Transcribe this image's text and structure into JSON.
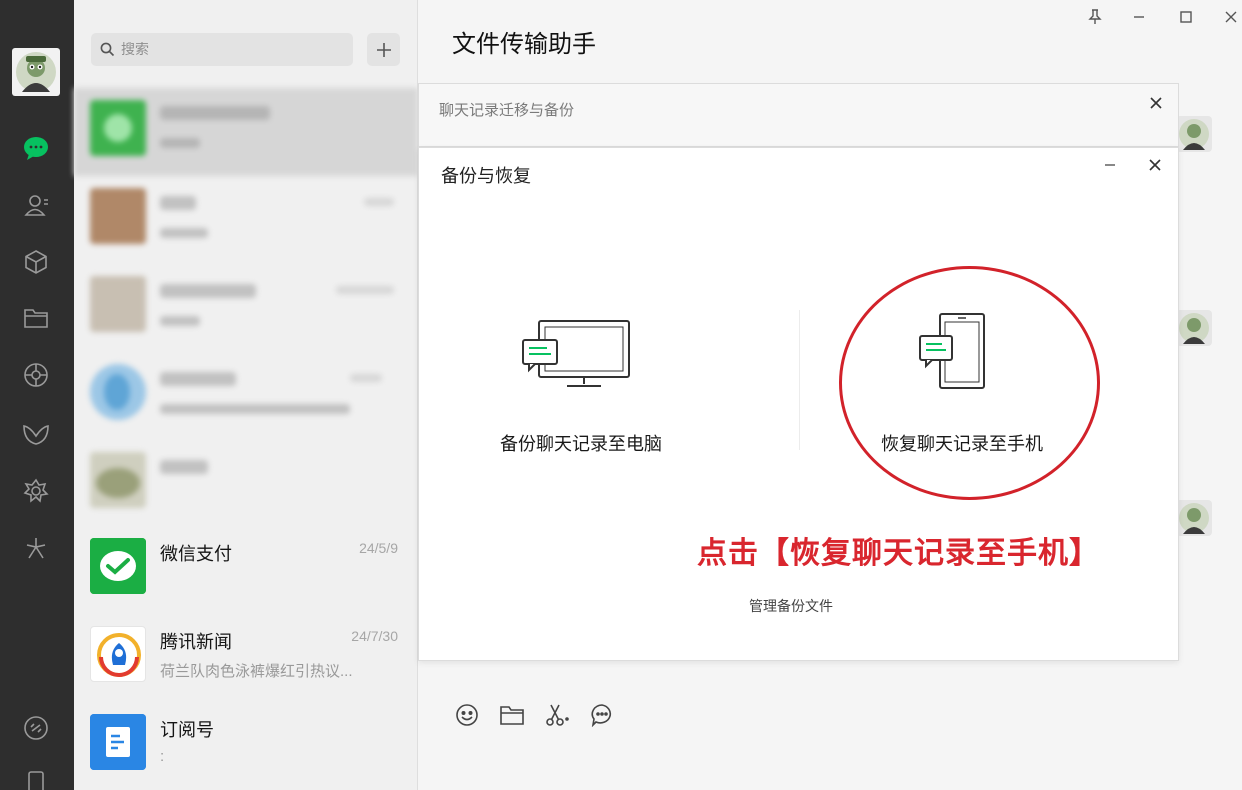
{
  "search": {
    "placeholder": "搜索"
  },
  "chat_list": [
    {
      "name": "微信支付",
      "time": "24/5/9",
      "preview": ""
    },
    {
      "name": "腾讯新闻",
      "time": "24/7/30",
      "preview": "荷兰队肉色泳裤爆红引热议..."
    },
    {
      "name": "订阅号",
      "time": "",
      "preview": ":"
    }
  ],
  "chat": {
    "title": "文件传输助手"
  },
  "migrate_panel": {
    "title": "聊天记录迁移与备份"
  },
  "backup_dialog": {
    "title": "备份与恢复",
    "option_pc_label": "备份聊天记录至电脑",
    "option_phone_label": "恢复聊天记录至手机",
    "manage_link": "管理备份文件",
    "annotation": "点击【恢复聊天记录至手机】"
  },
  "colors": {
    "accent_green": "#07c160",
    "annotation_red": "#d9262e",
    "rail": "#2e2e2e"
  }
}
